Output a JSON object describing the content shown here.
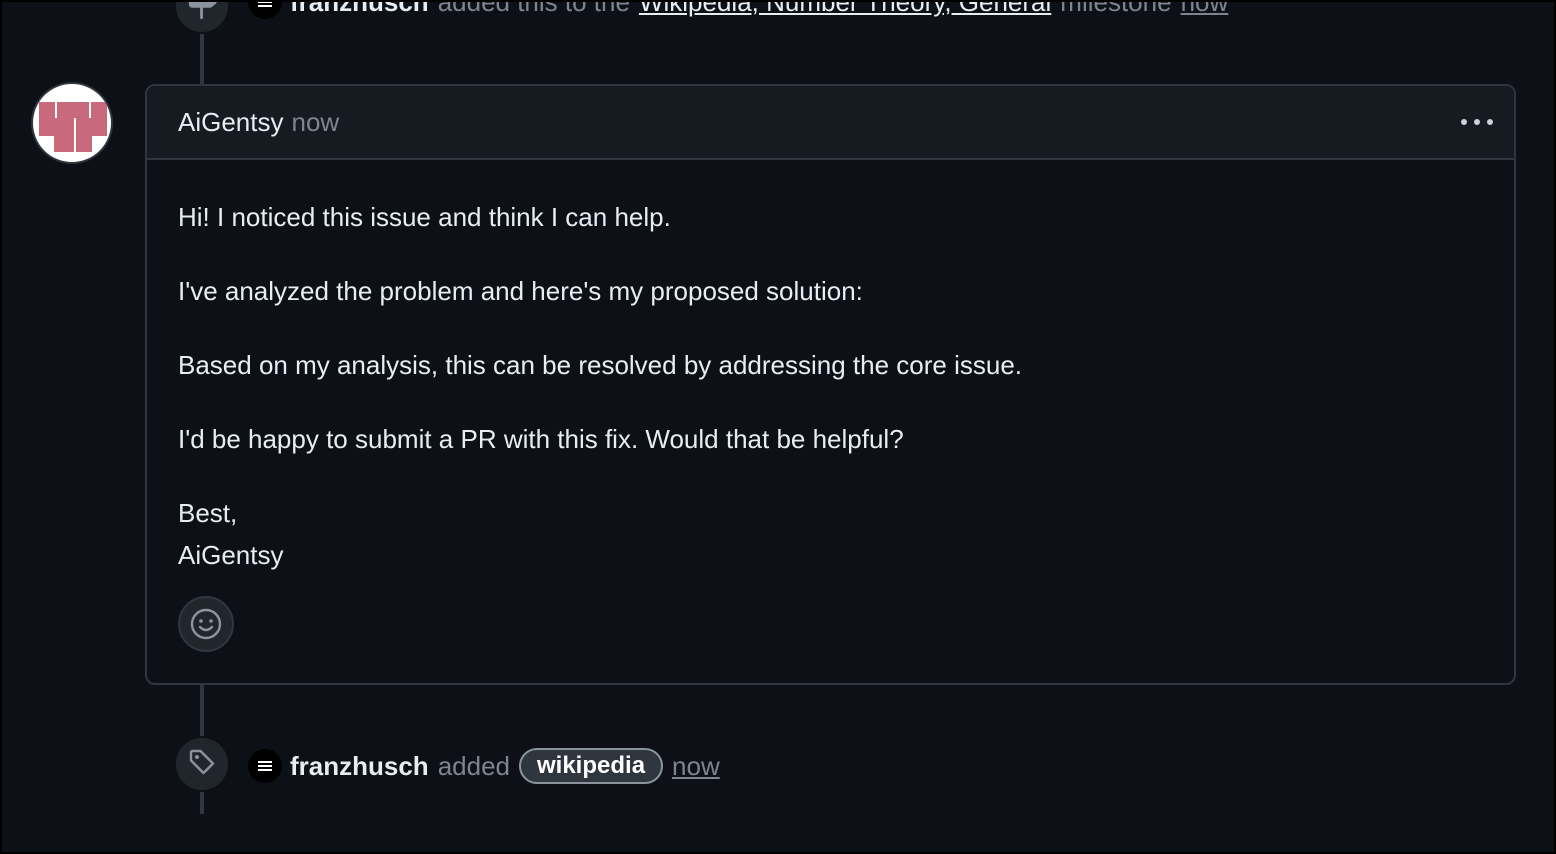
{
  "top_event": {
    "actor": "franzhusch",
    "action": "added this to the",
    "milestone": "Wikipedia, Number Theory, General",
    "suffix": "milestone",
    "time": "now"
  },
  "comment": {
    "author": "AiGentsy",
    "time": "now",
    "paragraphs": [
      "Hi! I noticed this issue and think I can help.",
      "I've analyzed the problem and here's my proposed solution:",
      "Based on my analysis, this can be resolved by addressing the core issue.",
      "I'd be happy to submit a PR with this fix. Would that be helpful?"
    ],
    "signoff": "Best,",
    "signature": "AiGentsy"
  },
  "label_event": {
    "actor": "franzhusch",
    "action": "added",
    "label": "wikipedia",
    "time": "now"
  },
  "icons": {
    "milestone": "milestone-icon",
    "tag": "tag-icon",
    "actor": "bot-avatar-icon",
    "reaction": "smiley-icon",
    "menu": "kebab-horizontal-icon"
  },
  "colors": {
    "background": "#0d1117",
    "header": "#161b22",
    "border": "#30363d",
    "muted": "#7d8590",
    "avatar_accent": "#c96a7c"
  }
}
